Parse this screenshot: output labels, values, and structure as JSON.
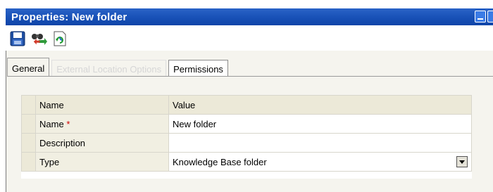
{
  "window": {
    "title": "Properties: New folder"
  },
  "toolbar": {
    "buttons": [
      {
        "icon": "floppy-disk-save-icon"
      },
      {
        "icon": "find-replace-binoculars-icon"
      },
      {
        "icon": "refresh-icon"
      }
    ]
  },
  "tabs": [
    {
      "label": "General",
      "state": "active"
    },
    {
      "label": "External Location Options",
      "state": "disabled"
    },
    {
      "label": "Permissions",
      "state": "normal"
    }
  ],
  "grid": {
    "headers": {
      "name": "Name",
      "value": "Value"
    },
    "rows": [
      {
        "name": "Name",
        "required_mark": "*",
        "value": "New folder"
      },
      {
        "name": "Description",
        "value": ""
      },
      {
        "name": "Type",
        "value": "Knowledge Base folder"
      }
    ]
  },
  "colors": {
    "titlebar": "#1a52b8",
    "required": "#d00000",
    "panel": "#f5f4ee",
    "grid_header": "#ece9d8"
  }
}
